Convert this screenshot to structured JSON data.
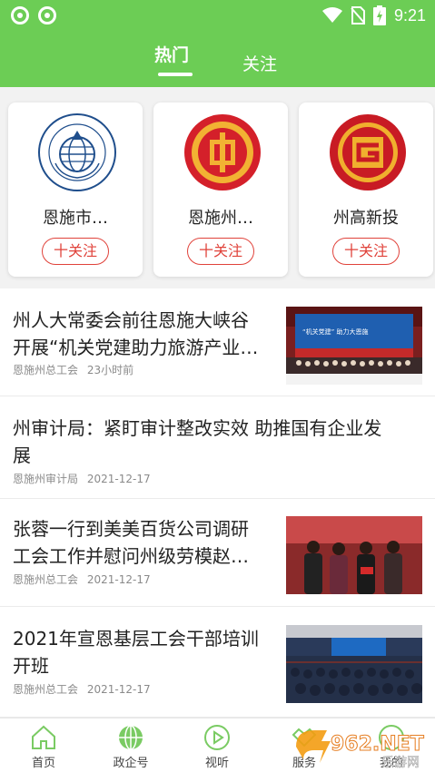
{
  "status_bar": {
    "time": "9:21"
  },
  "tabs": [
    {
      "label": "热门"
    },
    {
      "label": "关注"
    }
  ],
  "accounts": [
    {
      "name": "恩施市…",
      "follow_label": "十关注",
      "logo_text": "恩施市科学技术协会 ENSHI ASSOCIATION FOR SCIENCE AND TECHNOLOGY"
    },
    {
      "name": "恩施州…",
      "follow_label": "十关注"
    },
    {
      "name": "州高新投",
      "follow_label": "十关注"
    }
  ],
  "news": [
    {
      "title_line1": "州人大常委会前往恩施大峡谷",
      "title_line2": "开展“机关党建助力旅游产业…",
      "source": "恩施州总工会",
      "time": "23小时前",
      "thumb_banner": "“机关党建” 助力大恩施"
    },
    {
      "title_line1": "州审计局：紧盯审计整改实效 助推国有企业发",
      "title_line2": "展",
      "source": "恩施州审计局",
      "time": "2021-12-17"
    },
    {
      "title_line1": "张蓉一行到美美百货公司调研",
      "title_line2": "工会工作并慰问州级劳模赵…",
      "source": "恩施州总工会",
      "time": "2021-12-17"
    },
    {
      "title_line1": "2021年宣恩基层工会干部培训",
      "title_line2": "开班",
      "source": "恩施州总工会",
      "time": "2021-12-17"
    }
  ],
  "bottom_nav": [
    {
      "label": "首页"
    },
    {
      "label": "政企号"
    },
    {
      "label": "视听"
    },
    {
      "label": "服务"
    },
    {
      "label": "我的"
    }
  ],
  "watermark": {
    "text": "962.NET",
    "subtext": "乐游网"
  },
  "colors": {
    "brand_green": "#6ccd55",
    "follow_red": "#e0423a",
    "nav_icon_green": "#7acb63"
  }
}
